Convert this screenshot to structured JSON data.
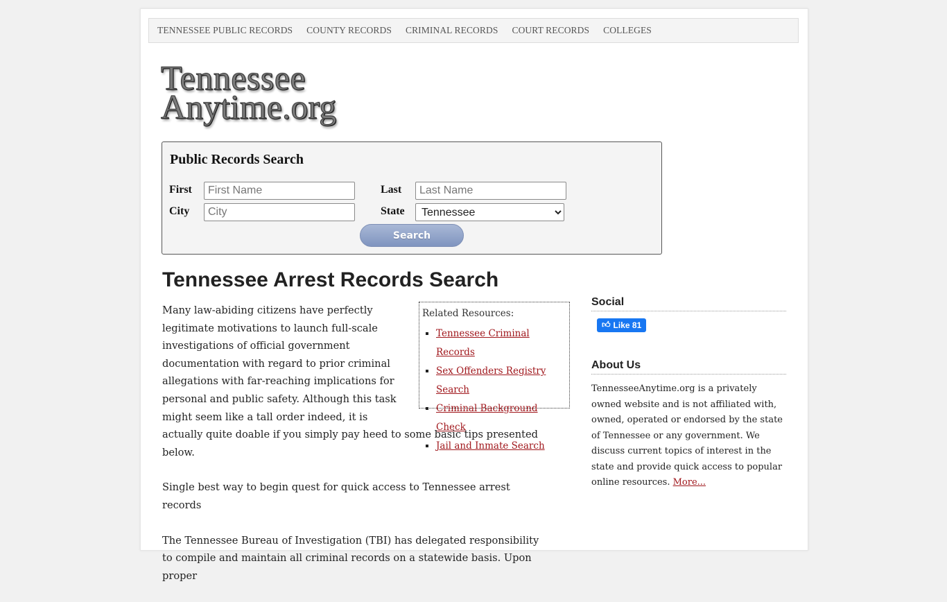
{
  "nav": {
    "items": [
      {
        "label": "TENNESSEE PUBLIC RECORDS"
      },
      {
        "label": "COUNTY RECORDS"
      },
      {
        "label": "CRIMINAL RECORDS"
      },
      {
        "label": "COURT RECORDS"
      },
      {
        "label": "COLLEGES"
      }
    ]
  },
  "logo": {
    "line1": "Tennessee",
    "line2": "Anytime.org"
  },
  "search": {
    "title": "Public Records Search",
    "first_label": "First",
    "first_placeholder": "First Name",
    "last_label": "Last",
    "last_placeholder": "Last Name",
    "city_label": "City",
    "city_placeholder": "City",
    "state_label": "State",
    "state_selected": "Tennessee",
    "button_label": "Search",
    "button_color": "#8a9dc6"
  },
  "article": {
    "title": "Tennessee Arrest Records Search",
    "paragraphs": [
      "Many law-abiding citizens have perfectly legitimate motivations to launch full-scale investigations of official government documentation with regard to prior criminal allegations with far-reaching implications for personal and public safety. Although this task might seem like a tall order indeed, it is actually quite doable if you simply pay heed to some basic tips presented below.",
      "Single best way to begin quest for quick access to Tennessee arrest records",
      "The Tennessee Bureau of Investigation (TBI) has delegated responsibility to compile and maintain all criminal records on a statewide basis. Upon proper"
    ],
    "related": {
      "title": "Related Resources:",
      "links": [
        {
          "label": "Tennessee Criminal Records"
        },
        {
          "label": "Sex Offenders Registry Search"
        },
        {
          "label": "Criminal Background Check"
        },
        {
          "label": "Jail and Inmate Search"
        }
      ],
      "link_color": "#a0171c"
    }
  },
  "sidebar": {
    "social_title": "Social",
    "like_label": "Like",
    "like_count": "81",
    "like_color": "#1877f2",
    "about_title": "About Us",
    "about_text": "TennesseeAnytime.org is a privately owned website and is not affiliated with, owned, operated or endorsed by the state of Tennessee or any government. We discuss current topics of interest in the state and provide quick access to popular online resources. ",
    "about_more": "More..."
  }
}
